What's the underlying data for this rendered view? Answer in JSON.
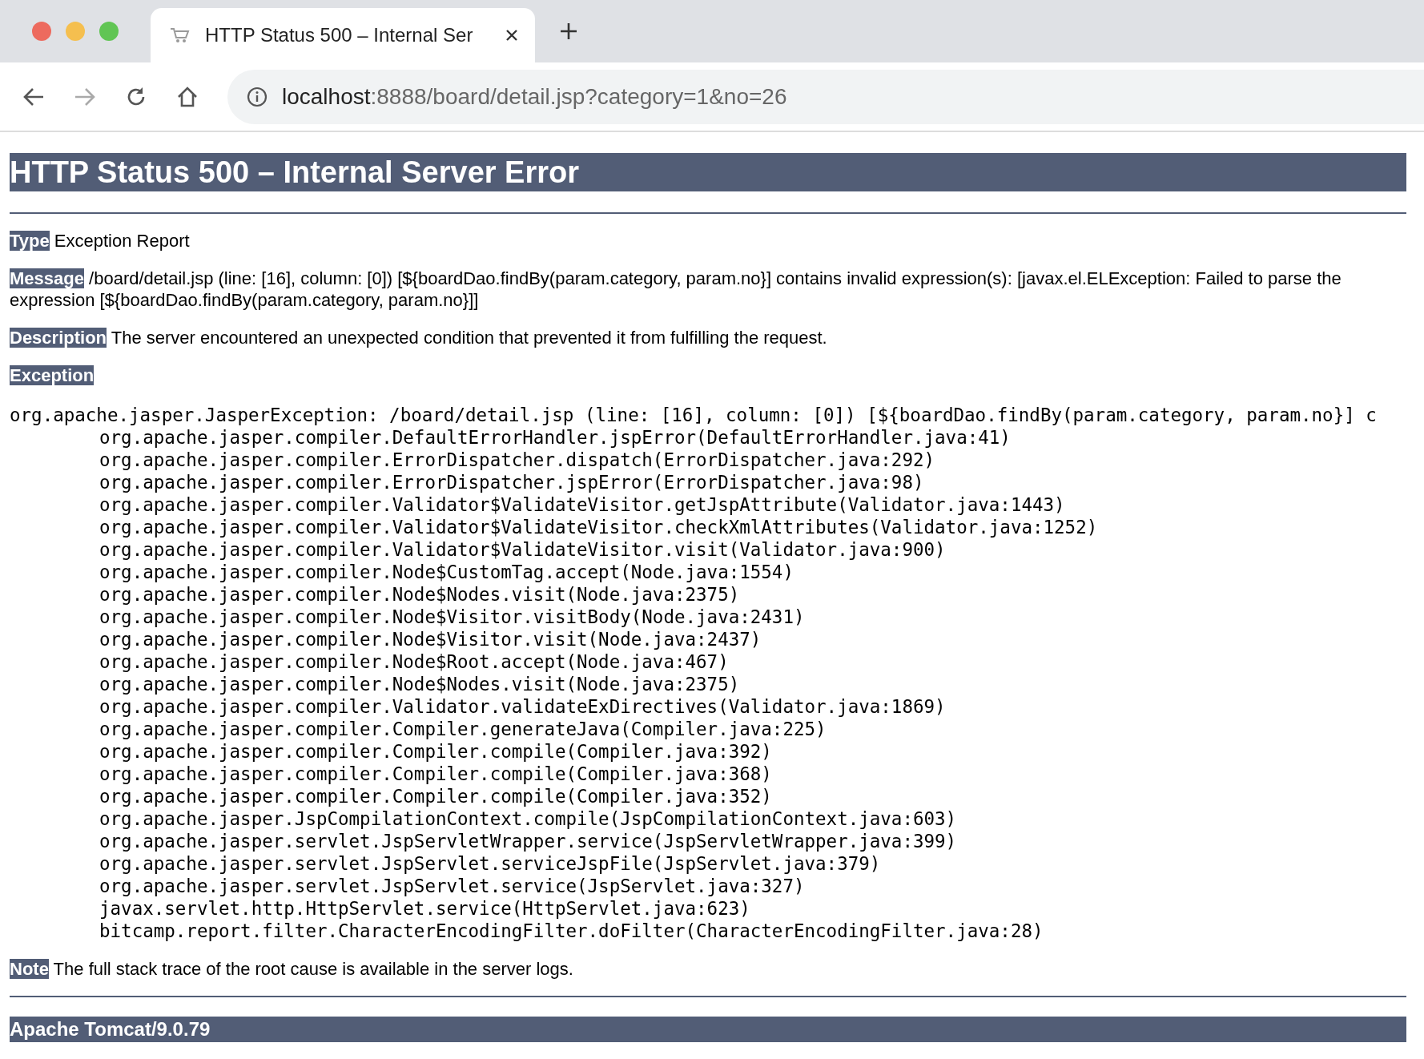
{
  "tab": {
    "title": "HTTP Status 500 – Internal Ser",
    "selected": true
  },
  "address": {
    "host": "localhost",
    "path": ":8888/board/detail.jsp?category=1&no=26"
  },
  "heading": "HTTP Status 500 – Internal Server Error",
  "fields": [
    {
      "label": "Type",
      "text": "Exception Report"
    },
    {
      "label": "Message",
      "text": "/board/detail.jsp (line: [16], column: [0]) [${boardDao.findBy(param.category, param.no}] contains invalid expression(s): [javax.el.ELException: Failed to parse the expression [${boardDao.findBy(param.category, param.no}]]"
    },
    {
      "label": "Description",
      "text": "The server encountered an unexpected condition that prevented it from fulfilling the request."
    }
  ],
  "exception": {
    "label": "Exception",
    "first_line": "org.apache.jasper.JasperException: /board/detail.jsp (line: [16], column: [0]) [${boardDao.findBy(param.category, param.no}] c",
    "frames": [
      "org.apache.jasper.compiler.DefaultErrorHandler.jspError(DefaultErrorHandler.java:41)",
      "org.apache.jasper.compiler.ErrorDispatcher.dispatch(ErrorDispatcher.java:292)",
      "org.apache.jasper.compiler.ErrorDispatcher.jspError(ErrorDispatcher.java:98)",
      "org.apache.jasper.compiler.Validator$ValidateVisitor.getJspAttribute(Validator.java:1443)",
      "org.apache.jasper.compiler.Validator$ValidateVisitor.checkXmlAttributes(Validator.java:1252)",
      "org.apache.jasper.compiler.Validator$ValidateVisitor.visit(Validator.java:900)",
      "org.apache.jasper.compiler.Node$CustomTag.accept(Node.java:1554)",
      "org.apache.jasper.compiler.Node$Nodes.visit(Node.java:2375)",
      "org.apache.jasper.compiler.Node$Visitor.visitBody(Node.java:2431)",
      "org.apache.jasper.compiler.Node$Visitor.visit(Node.java:2437)",
      "org.apache.jasper.compiler.Node$Root.accept(Node.java:467)",
      "org.apache.jasper.compiler.Node$Nodes.visit(Node.java:2375)",
      "org.apache.jasper.compiler.Validator.validateExDirectives(Validator.java:1869)",
      "org.apache.jasper.compiler.Compiler.generateJava(Compiler.java:225)",
      "org.apache.jasper.compiler.Compiler.compile(Compiler.java:392)",
      "org.apache.jasper.compiler.Compiler.compile(Compiler.java:368)",
      "org.apache.jasper.compiler.Compiler.compile(Compiler.java:352)",
      "org.apache.jasper.JspCompilationContext.compile(JspCompilationContext.java:603)",
      "org.apache.jasper.servlet.JspServletWrapper.service(JspServletWrapper.java:399)",
      "org.apache.jasper.servlet.JspServlet.serviceJspFile(JspServlet.java:379)",
      "org.apache.jasper.servlet.JspServlet.service(JspServlet.java:327)",
      "javax.servlet.http.HttpServlet.service(HttpServlet.java:623)",
      "bitcamp.report.filter.CharacterEncodingFilter.doFilter(CharacterEncodingFilter.java:28)"
    ]
  },
  "note": {
    "label": "Note",
    "text": "The full stack trace of the root cause is available in the server logs."
  },
  "footer": "Apache Tomcat/9.0.79"
}
